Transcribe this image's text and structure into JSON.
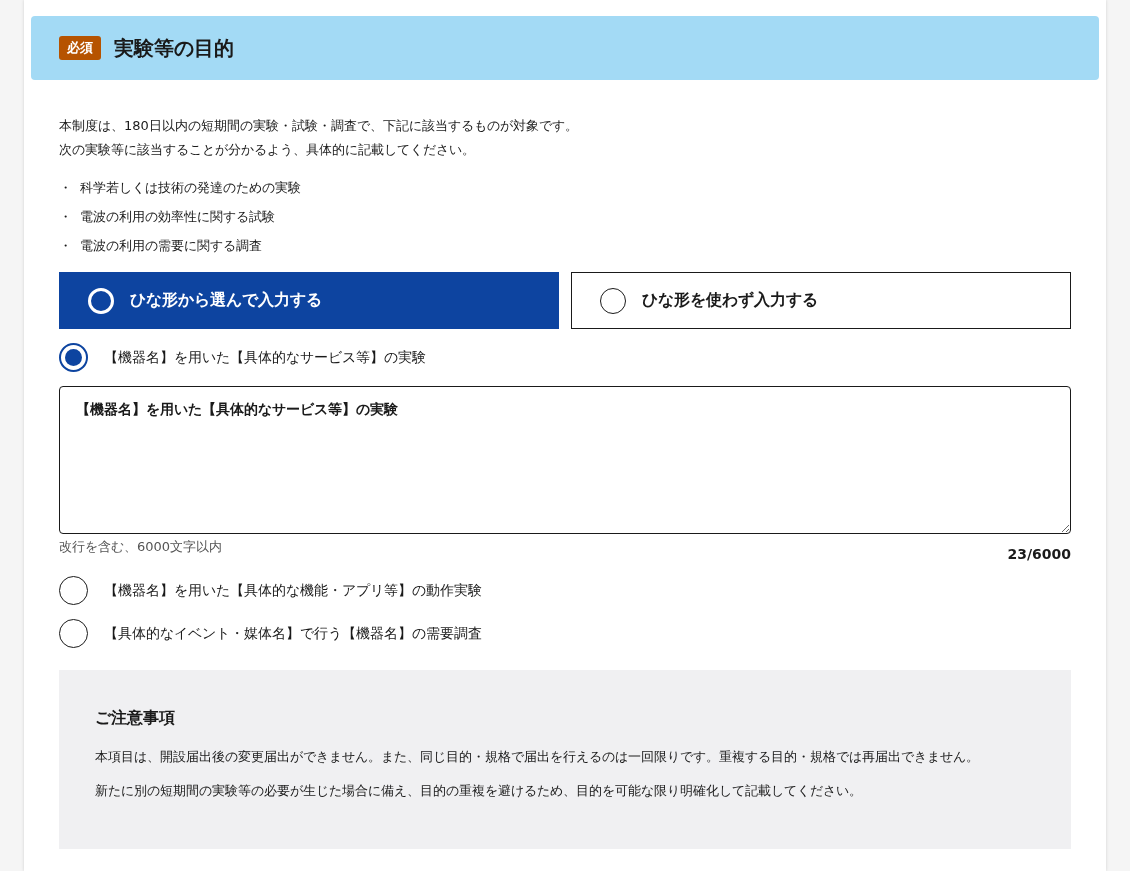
{
  "header": {
    "badge": "必須",
    "title": "実験等の目的"
  },
  "intro": [
    "本制度は、180日以内の短期間の実験・試験・調査で、下記に該当するものが対象です。",
    "次の実験等に該当することが分かるよう、具体的に記載してください。"
  ],
  "bullets": [
    {
      "mark": "・",
      "text": "科学若しくは技術の発達のための実験"
    },
    {
      "mark": "・",
      "text": "電波の利用の効率性に関する試験"
    },
    {
      "mark": "・",
      "text": "電波の利用の需要に関する調査"
    }
  ],
  "modes": [
    {
      "label": "ひな形から選んで入力する",
      "selected": true
    },
    {
      "label": "ひな形を使わず入力する",
      "selected": false
    }
  ],
  "templates": [
    {
      "label": "【機器名】を用いた【具体的なサービス等】の実験",
      "selected": true
    },
    {
      "label": "【機器名】を用いた【具体的な機能・アプリ等】の動作実験",
      "selected": false
    },
    {
      "label": "【具体的なイベント・媒体名】で行う【機器名】の需要調査",
      "selected": false
    }
  ],
  "textarea": {
    "value": "【機器名】を用いた【具体的なサービス等】の実験",
    "hint": "改行を含む、6000文字以内",
    "count": "23/6000"
  },
  "notice": {
    "title": "ご注意事項",
    "paragraphs": [
      "本項目は、開設届出後の変更届出ができません。また、同じ目的・規格で届出を行えるのは一回限りです。重複する目的・規格では再届出できません。",
      "新たに別の短期間の実験等の必要が生じた場合に備え、目的の重複を避けるため、目的を可能な限り明確化して記載してください。"
    ]
  }
}
